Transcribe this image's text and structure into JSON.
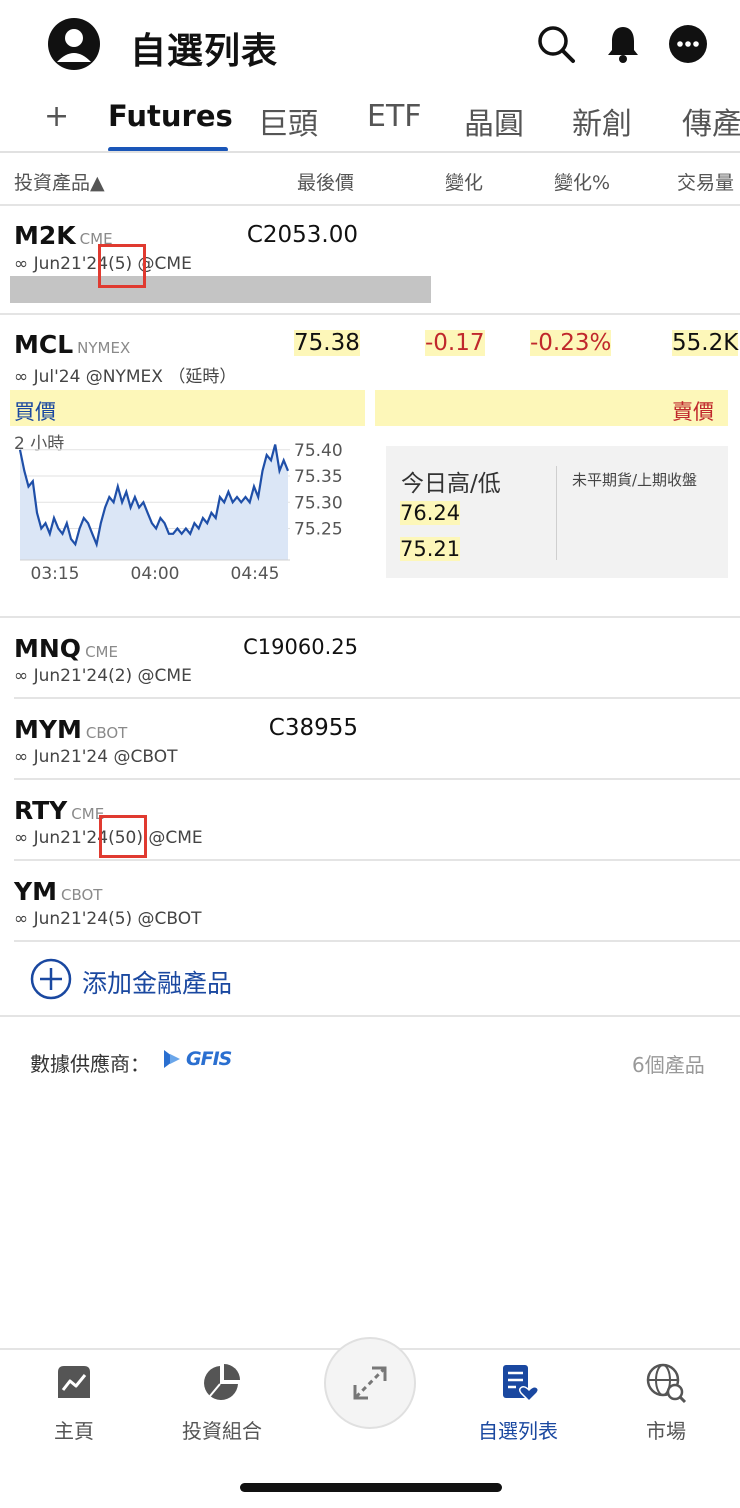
{
  "header": {
    "title": "自選列表",
    "icons": [
      "avatar-icon",
      "search-icon",
      "bell-icon",
      "more-icon"
    ]
  },
  "tabs": [
    {
      "label": "+"
    },
    {
      "label": "Futures",
      "active": true
    },
    {
      "label": "巨頭"
    },
    {
      "label": "ETF"
    },
    {
      "label": "晶圓"
    },
    {
      "label": "新創"
    },
    {
      "label": "傳產"
    }
  ],
  "columns": {
    "product": "投資產品▲",
    "last": "最後價",
    "change": "變化",
    "change_pct": "變化%",
    "volume": "交易量"
  },
  "rows": {
    "m2k": {
      "symbol": "M2K",
      "exchange": "CME",
      "sub": "∞ Jun21'24(5) @CME",
      "last": "C2053.00"
    },
    "mcl": {
      "symbol": "MCL",
      "exchange": "NYMEX",
      "sub": "∞ Jul'24 @NYMEX （延時）",
      "last": "75.38",
      "change": "-0.17",
      "change_pct": "-0.23%",
      "volume": "55.2K"
    },
    "mnq": {
      "symbol": "MNQ",
      "exchange": "CME",
      "sub": "∞ Jun21'24(2) @CME",
      "last": "C19060.25"
    },
    "mym": {
      "symbol": "MYM",
      "exchange": "CBOT",
      "sub": "∞ Jun21'24 @CBOT",
      "last": "C38955"
    },
    "rty": {
      "symbol": "RTY",
      "exchange": "CME",
      "sub": "∞ Jun21'24(50) @CME"
    },
    "ym": {
      "symbol": "YM",
      "exchange": "CBOT",
      "sub": "∞ Jun21'24(5) @CBOT"
    }
  },
  "mcl_detail": {
    "bid_label": "買價",
    "ask_label": "賣價",
    "chart_period": "2 小時",
    "day_hl_label": "今日高/低",
    "open_interest_label": "未平期貨/上期收盤",
    "day_high": "76.24",
    "day_low": "75.21"
  },
  "chart_data": {
    "type": "area",
    "title": "",
    "xlabel": "",
    "ylabel": "",
    "x_ticks": [
      "03:15",
      "04:00",
      "04:45"
    ],
    "y_ticks": [
      "75.40",
      "75.35",
      "75.30",
      "75.25"
    ],
    "ylim": [
      75.19,
      75.43
    ],
    "series": [
      {
        "values": [
          75.4,
          75.36,
          75.33,
          75.34,
          75.28,
          75.25,
          75.26,
          75.24,
          75.27,
          75.25,
          75.24,
          75.26,
          75.23,
          75.22,
          75.25,
          75.27,
          75.26,
          75.24,
          75.22,
          75.26,
          75.29,
          75.31,
          75.3,
          75.33,
          75.3,
          75.32,
          75.29,
          75.31,
          75.29,
          75.3,
          75.28,
          75.26,
          75.25,
          75.27,
          75.26,
          75.24,
          75.24,
          75.25,
          75.24,
          75.25,
          75.24,
          75.26,
          75.25,
          75.27,
          75.26,
          75.28,
          75.27,
          75.31,
          75.3,
          75.32,
          75.3,
          75.31,
          75.3,
          75.31,
          75.3,
          75.33,
          75.31,
          75.36,
          75.39,
          75.38,
          75.41,
          75.36,
          75.38,
          75.36
        ]
      }
    ],
    "color": "#1f4fa8",
    "fill": "#dbe6f6",
    "grid": true
  },
  "add_product": "添加金融產品",
  "footer": {
    "provider_label": "數據供應商：",
    "provider_logo": "GFIS",
    "count": "6個產品"
  },
  "nav": [
    {
      "label": "主頁",
      "icon": "home-chart-icon"
    },
    {
      "label": "投資組合",
      "icon": "pie-chart-icon"
    },
    {
      "label": "自選列表",
      "icon": "watchlist-icon",
      "active": true
    },
    {
      "label": "市場",
      "icon": "globe-search-icon"
    }
  ],
  "colors": {
    "accent": "#1a48a0",
    "highlight": "#fdf7b9",
    "negative": "#c0282c"
  }
}
